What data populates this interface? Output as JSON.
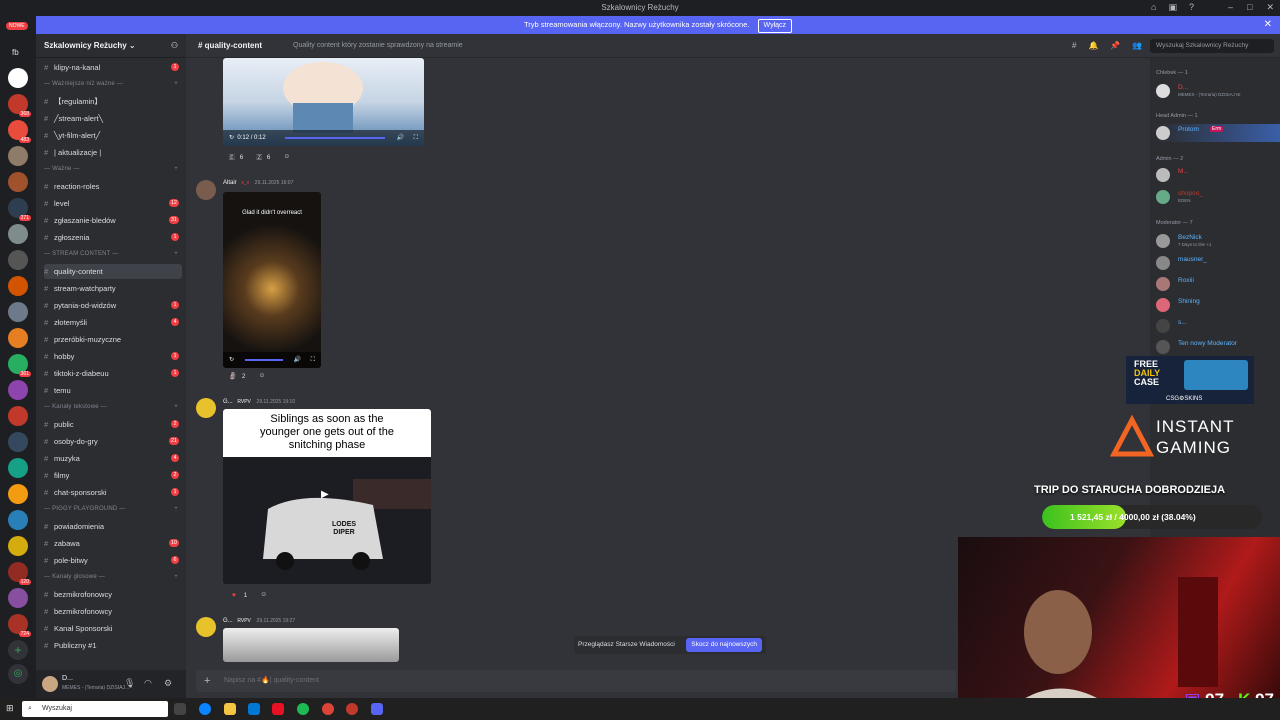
{
  "window": {
    "title": "Szkalownicy Reżuchy"
  },
  "banner": {
    "text": "Tryb streamowania włączony. Nazwy użytkownika zostały skrócone.",
    "button": "Wyłącz"
  },
  "servers": {
    "new_label": "NOWE",
    "fb_label": "fb",
    "badges": [
      "368",
      "483",
      "271",
      "361",
      "120",
      "724"
    ]
  },
  "guild": {
    "name": "Szkalownicy Reżuchy"
  },
  "channels": [
    {
      "type": "channel",
      "name": "klipy-na-kanal",
      "count": "1"
    },
    {
      "type": "category",
      "name": "Ważniejsze niż ważne"
    },
    {
      "type": "channel",
      "name": "【regulamin】",
      "count": ""
    },
    {
      "type": "channel",
      "name": "╱stream-alert╲",
      "count": ""
    },
    {
      "type": "channel",
      "name": "╲yt-film-alert╱",
      "count": ""
    },
    {
      "type": "channel",
      "name": "| aktualizacje |",
      "count": ""
    },
    {
      "type": "category",
      "name": "Ważne"
    },
    {
      "type": "channel",
      "name": "reaction-roles",
      "count": ""
    },
    {
      "type": "channel",
      "name": "level",
      "count": "12"
    },
    {
      "type": "channel",
      "name": "zgłaszanie-bledów",
      "count": "31"
    },
    {
      "type": "channel",
      "name": "zgłoszenia",
      "count": "1"
    },
    {
      "type": "category",
      "name": "STREAM CONTENT"
    },
    {
      "type": "channel",
      "name": "quality-content",
      "count": "",
      "selected": true
    },
    {
      "type": "channel",
      "name": "stream-watchparty",
      "count": ""
    },
    {
      "type": "channel",
      "name": "pytania-od-widzów",
      "count": "1"
    },
    {
      "type": "channel",
      "name": "złotemyśli",
      "count": "4"
    },
    {
      "type": "channel",
      "name": "przeróbki-muzyczne",
      "count": ""
    },
    {
      "type": "channel",
      "name": "hobby",
      "count": "1"
    },
    {
      "type": "channel",
      "name": "tiktoki-z-diabeuu",
      "count": "1"
    },
    {
      "type": "channel",
      "name": "temu",
      "count": ""
    },
    {
      "type": "category",
      "name": "Kanały tekstowe"
    },
    {
      "type": "channel",
      "name": "public",
      "count": "2"
    },
    {
      "type": "channel",
      "name": "osoby-do-gry",
      "count": "21"
    },
    {
      "type": "channel",
      "name": "muzyka",
      "count": "4"
    },
    {
      "type": "channel",
      "name": "filmy",
      "count": "2"
    },
    {
      "type": "channel",
      "name": "chat-sponsorski",
      "count": "1"
    },
    {
      "type": "category",
      "name": "PIGGY PLAYGROUND"
    },
    {
      "type": "channel",
      "name": "powiadomienia",
      "count": ""
    },
    {
      "type": "channel",
      "name": "zabawa",
      "count": "10"
    },
    {
      "type": "channel",
      "name": "pole-bitwy",
      "count": "6"
    },
    {
      "type": "category",
      "name": "Kanały głosowe"
    },
    {
      "type": "channel",
      "name": "bezmikrofonowcy",
      "count": ""
    },
    {
      "type": "channel",
      "name": "bezmikrofonowcy",
      "count": ""
    },
    {
      "type": "channel",
      "name": "Kanał Sponsorski",
      "count": ""
    },
    {
      "type": "channel",
      "name": "Publiczny #1",
      "count": ""
    }
  ],
  "user": {
    "name": "D...",
    "status": "MEMES - (Terraria) DZISIAJ..."
  },
  "chat": {
    "channel": "quality-content",
    "topic": "Quality content który zostanie sprawdzony na streamie",
    "search_placeholder": "Wyszukaj Szkalownicy Reżuchy",
    "composer_placeholder": "Napisz na #",
    "composer_channel": "| quality-content",
    "jump_text": "Przeglądasz Starsze Wiadomości",
    "jump_button": "Skocz do najnowszych"
  },
  "messages": [
    {
      "video_time": "0:12 / 0:12",
      "reactions": [
        "6",
        "6"
      ]
    },
    {
      "author": "Altair",
      "tag": "x_x",
      "timestamp": "29.11.2025 16:07",
      "caption": "Glad it didn't overreact",
      "reactions": [
        "2"
      ]
    },
    {
      "author": "G...",
      "tag": "RVPV",
      "timestamp": "29.11.2025 19:10",
      "caption": "Siblings as soon as the younger one gets out of the snitching phase",
      "van_text": "LODES DIPER",
      "reactions": [
        "1"
      ]
    },
    {
      "author": "G...",
      "tag": "RVPV",
      "timestamp": "29.11.2025 19:27"
    }
  ],
  "members": {
    "categories": [
      "Chlebek — 1",
      "Head Admin — 1",
      "Admin — 2",
      "Moderator — 7"
    ],
    "list": [
      {
        "name": "D...",
        "status": "MEMES - (Terraria) DZISIAJ NI",
        "color": "#f23f43"
      },
      {
        "name": "Protom",
        "status": "",
        "color": "#5fb3ff",
        "tag": "Erm"
      },
      {
        "name": "M...",
        "status": "",
        "color": "#f23f43"
      },
      {
        "name": "shopoo_",
        "status": "EDEN",
        "color": "#c0392b"
      },
      {
        "name": "BezNick",
        "status": "7 Days to Die +1",
        "color": "#5fb3ff"
      },
      {
        "name": "mausner_",
        "status": "",
        "color": "#5fb3ff"
      },
      {
        "name": "Roxiii",
        "status": "",
        "color": "#5fb3ff"
      },
      {
        "name": "Shining",
        "status": "",
        "color": "#5fb3ff"
      },
      {
        "name": "s...",
        "status": "",
        "color": "#5fb3ff"
      },
      {
        "name": "Ten nowy Moderator",
        "status": "",
        "color": "#5fb3ff"
      }
    ]
  },
  "overlay": {
    "promo_line1": "FREE",
    "promo_line2": "DAILY",
    "promo_line3": "CASE",
    "promo_brand": "CSG⚙SKINS",
    "ig_line1": "INSTANT",
    "ig_line2": "GAMING",
    "goal_title": "TRIP DO STARUCHA DOBRODZIEJA",
    "goal_text": "1 521,45 zł / 4000,00 zł (38.04%)",
    "goal_fraction": 0.3804,
    "twitch_count": "97",
    "kick_count": "97"
  },
  "taskbar": {
    "search": "Wyszukaj"
  },
  "colors": {
    "accent": "#5865f2",
    "danger": "#f23f43",
    "goal": "#3cc21e"
  }
}
